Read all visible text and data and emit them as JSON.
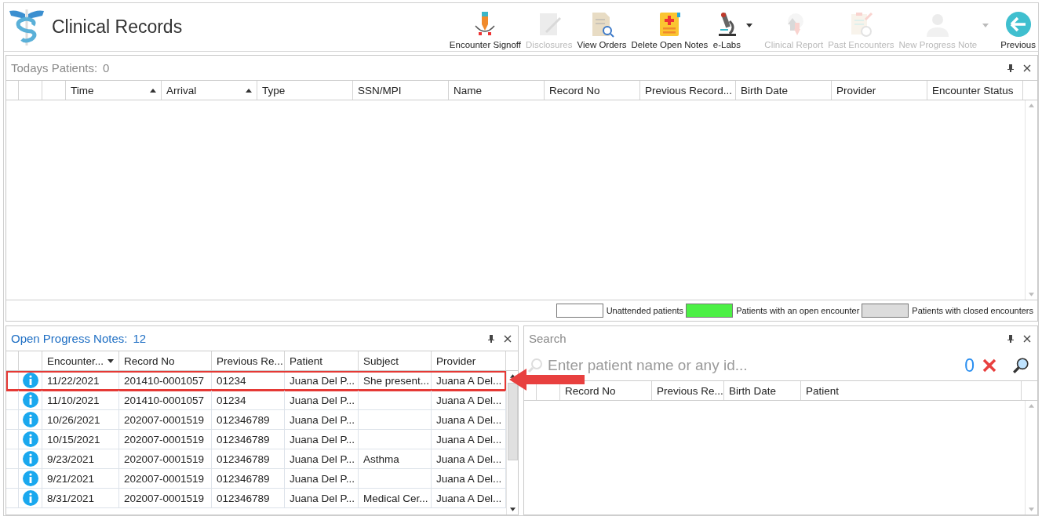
{
  "app": {
    "title": "Clinical Records"
  },
  "toolbar": [
    {
      "label": "Encounter Signoff",
      "kind": "pen",
      "disabled": false
    },
    {
      "label": "Disclosures",
      "kind": "document",
      "disabled": true
    },
    {
      "label": "View Orders",
      "kind": "orders",
      "disabled": false
    },
    {
      "label": "Delete Open Notes",
      "kind": "notes",
      "disabled": false
    },
    {
      "label": "e-Labs",
      "kind": "microscope",
      "disabled": false,
      "dropdown": true
    },
    {
      "label": "Clinical Report",
      "kind": "report",
      "disabled": true
    },
    {
      "label": "Past Encounters",
      "kind": "clipboard",
      "disabled": true
    },
    {
      "label": "New Progress Note",
      "kind": "doctor",
      "disabled": true,
      "dropdown": true
    },
    {
      "label": "Previous",
      "kind": "back",
      "disabled": false
    }
  ],
  "todays_patients": {
    "title": "Todays Patients:",
    "count": "0",
    "columns": [
      {
        "label": "Time",
        "kind": "ascending"
      },
      {
        "label": "Arrival",
        "kind": "ascending"
      },
      {
        "label": "Type",
        "kind": "plain"
      },
      {
        "label": "SSN/MPI",
        "kind": "plain"
      },
      {
        "label": "Name",
        "kind": "plain"
      },
      {
        "label": "Record No",
        "kind": "plain"
      },
      {
        "label": "Previous Record...",
        "kind": "plain"
      },
      {
        "label": "Birth Date",
        "kind": "plain"
      },
      {
        "label": "Provider",
        "kind": "plain"
      },
      {
        "label": "Encounter Status",
        "kind": "plain"
      }
    ],
    "legend": [
      {
        "label": "Unattended patients",
        "color": "#ffffff"
      },
      {
        "label": "Patients with an open encounter",
        "color": "#4cf045"
      },
      {
        "label": "Patients with closed encounters",
        "color": "#dcdcdc"
      }
    ]
  },
  "open_progress_notes": {
    "title": "Open Progress Notes:",
    "count": "12",
    "columns": [
      {
        "label": "Encounter...",
        "kind": "descending"
      },
      {
        "label": "Record No",
        "kind": "plain"
      },
      {
        "label": "Previous Re...",
        "kind": "plain"
      },
      {
        "label": "Patient",
        "kind": "plain"
      },
      {
        "label": "Subject",
        "kind": "plain"
      },
      {
        "label": "Provider",
        "kind": "plain"
      }
    ],
    "rows": [
      {
        "encounter_date": "11/22/2021",
        "record_no": "201410-0001057",
        "previous_record": "01234",
        "patient": "Juana Del P...",
        "subject": "She present...",
        "provider": "Juana A Del...",
        "highlighted": true
      },
      {
        "encounter_date": "11/10/2021",
        "record_no": "201410-0001057",
        "previous_record": "01234",
        "patient": "Juana Del P...",
        "provider": "Juana A Del...",
        "highlighted": false
      },
      {
        "encounter_date": "10/26/2021",
        "record_no": "202007-0001519",
        "previous_record": "012346789",
        "patient": "Juana Del P...",
        "provider": "Juana A Del...",
        "highlighted": false
      },
      {
        "encounter_date": "10/15/2021",
        "record_no": "202007-0001519",
        "previous_record": "012346789",
        "patient": "Juana Del P...",
        "provider": "Juana A Del...",
        "highlighted": false
      },
      {
        "encounter_date": "9/23/2021",
        "record_no": "202007-0001519",
        "previous_record": "012346789",
        "patient": "Juana Del P...",
        "subject": "Asthma",
        "provider": "Juana A Del...",
        "highlighted": false
      },
      {
        "encounter_date": "9/21/2021",
        "record_no": "202007-0001519",
        "previous_record": "012346789",
        "patient": "Juana Del P...",
        "provider": "Juana A Del...",
        "highlighted": false
      },
      {
        "encounter_date": "8/31/2021",
        "record_no": "202007-0001519",
        "previous_record": "012346789",
        "patient": "Juana Del P...",
        "subject": "Medical Cer...",
        "provider": "Juana A Del...",
        "highlighted": false
      }
    ]
  },
  "search": {
    "title": "Search",
    "placeholder": "Enter patient name or any id...",
    "count": "0",
    "columns": [
      {
        "label": "Record No"
      },
      {
        "label": "Previous Re..."
      },
      {
        "label": "Birth Date"
      },
      {
        "label": "Patient"
      }
    ]
  }
}
